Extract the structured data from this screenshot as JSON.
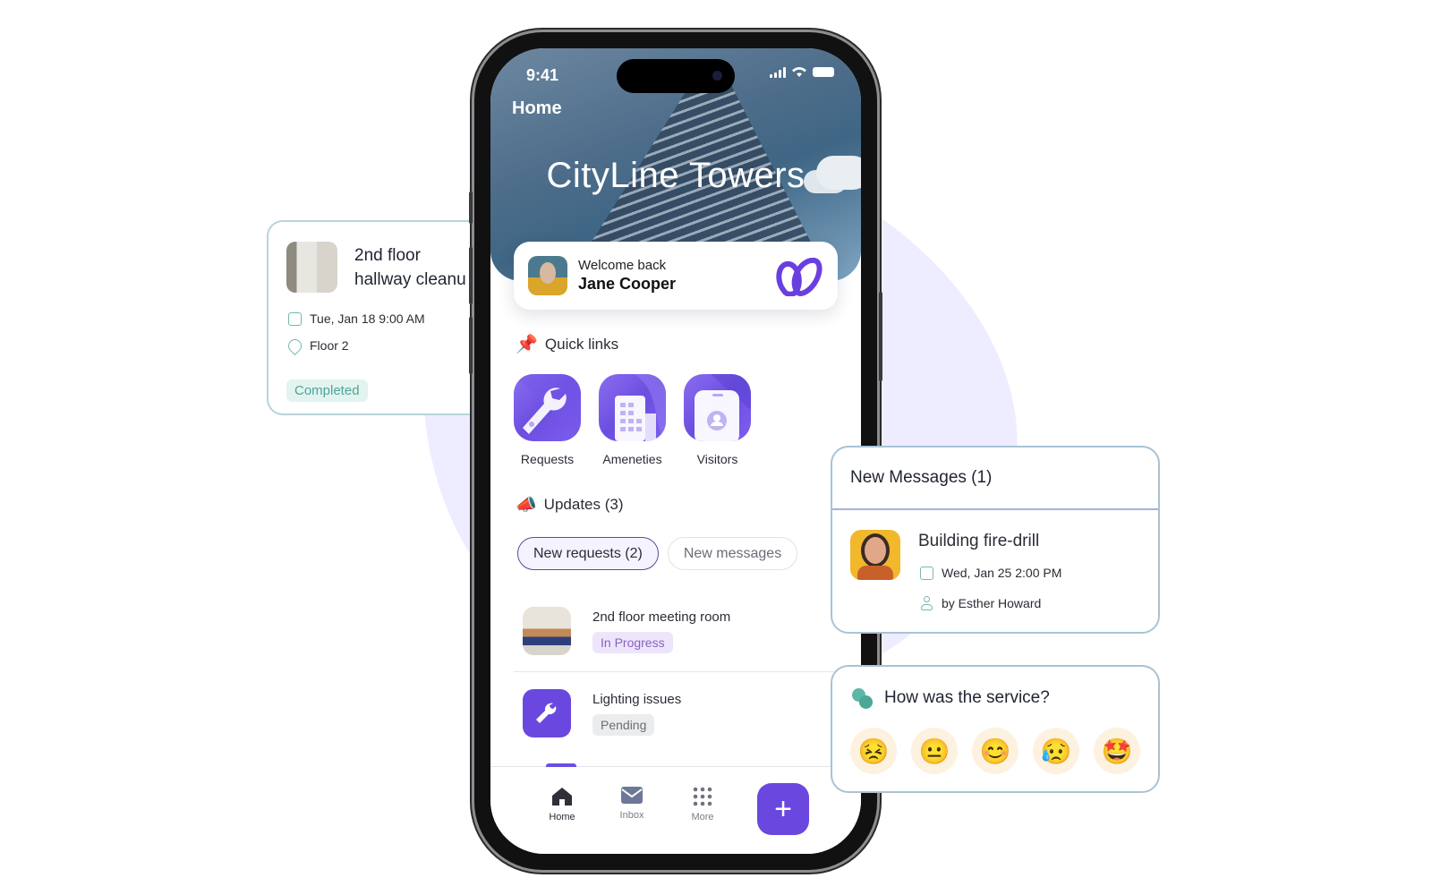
{
  "phone": {
    "status_bar": {
      "time": "9:41"
    },
    "header": {
      "title": "Home",
      "building_name": "CityLine Towers"
    },
    "welcome": {
      "greeting": "Welcome back",
      "user_name": "Jane Cooper"
    },
    "quick_links": {
      "title": "Quick links",
      "items": [
        {
          "label": "Requests",
          "icon": "wrench-icon"
        },
        {
          "label": "Ameneties",
          "icon": "building-icon"
        },
        {
          "label": "Visitors",
          "icon": "visitor-badge-icon"
        }
      ]
    },
    "updates": {
      "title": "Updates (3)",
      "tabs": [
        {
          "label": "New requests (2)",
          "active": true
        },
        {
          "label": "New messages",
          "active": false
        }
      ],
      "requests": [
        {
          "title": "2nd floor meeting room",
          "status": "In Progress",
          "status_color": "#8a5fc9",
          "status_bg": "#ede6fb"
        },
        {
          "title": "Lighting issues",
          "status": "Pending",
          "status_color": "#6b6e74",
          "status_bg": "#ebecee"
        }
      ]
    },
    "nav": {
      "items": [
        {
          "label": "Home",
          "icon": "home-icon",
          "active": true
        },
        {
          "label": "Inbox",
          "icon": "mail-icon",
          "active": false
        },
        {
          "label": "More",
          "icon": "grid-dots-icon",
          "active": false
        }
      ],
      "fab_label": "+"
    }
  },
  "task_card": {
    "title_line1": "2nd floor",
    "title_line2": "hallway cleanu",
    "date": "Tue, Jan 18  9:00 AM",
    "location": "Floor 2",
    "status": "Completed"
  },
  "messages_card": {
    "title": "New Messages (1)",
    "message": {
      "title": "Building fire-drill",
      "date": "Wed, Jan 25  2:00 PM",
      "author": "by Esther Howard"
    }
  },
  "feedback_card": {
    "question": "How was the service?",
    "options": [
      "😣",
      "😐",
      "😊",
      "😥",
      "🤩"
    ]
  },
  "colors": {
    "accent": "#6a48e0",
    "teal": "#74b8b0",
    "blob": "#eeedff"
  }
}
